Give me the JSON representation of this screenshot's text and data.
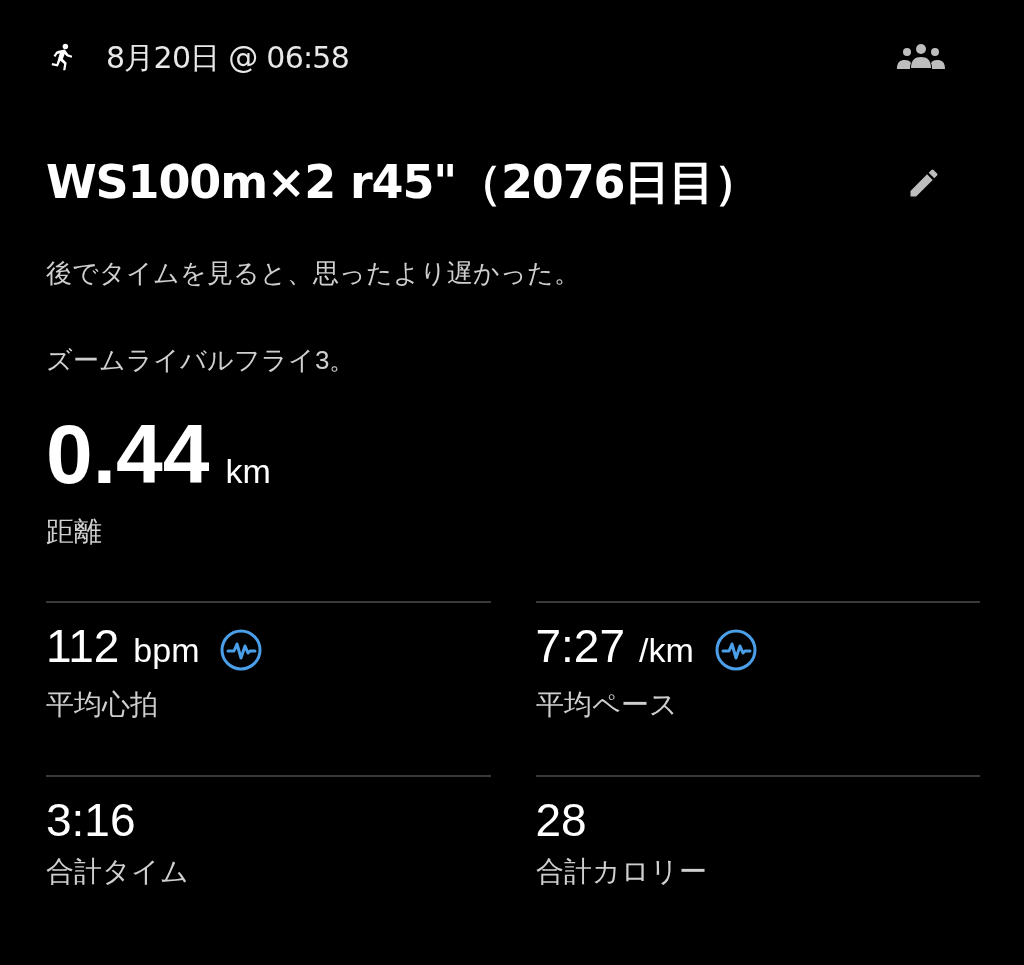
{
  "header": {
    "date": "8月20日 @ 06:58"
  },
  "title": "WS100m×2 r45\"（2076日目）",
  "notes": [
    "後でタイムを見ると、思ったより遅かった。",
    "ズームライバルフライ3。"
  ],
  "distance": {
    "value": "0.44",
    "unit": "km",
    "label": "距離"
  },
  "stats": [
    {
      "value": "112",
      "unit": "bpm",
      "label": "平均心拍",
      "sensor": true
    },
    {
      "value": "7:27",
      "unit": "/km",
      "label": "平均ペース",
      "sensor": true
    },
    {
      "value": "3:16",
      "label": "合計タイム",
      "sensor": false
    },
    {
      "value": "28",
      "label": "合計カロリー",
      "sensor": false
    }
  ]
}
